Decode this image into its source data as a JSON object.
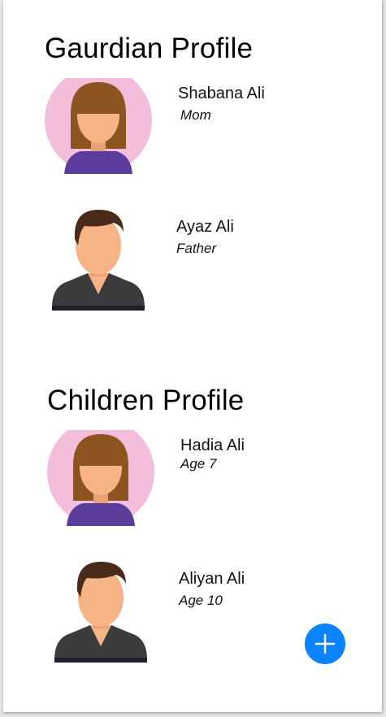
{
  "guardian_section": {
    "title": "Gaurdian Profile",
    "members": [
      {
        "name": "Shabana Ali",
        "role": "Mom",
        "avatar_icon": "female-avatar-icon"
      },
      {
        "name": "Ayaz Ali",
        "role": "Father",
        "avatar_icon": "male-avatar-icon"
      }
    ]
  },
  "children_section": {
    "title": "Children Profile",
    "members": [
      {
        "name": "Hadia Ali",
        "role": "Age 7",
        "avatar_icon": "female-avatar-icon"
      },
      {
        "name": "Aliyan Ali",
        "role": "Age 10",
        "avatar_icon": "male-avatar-icon"
      }
    ]
  },
  "fab": {
    "icon": "plus-icon",
    "color": "#0a84ff"
  },
  "colors": {
    "female_avatar_bg": "#f2bedb",
    "hair_female": "#8b5420",
    "hair_male": "#4a2a18",
    "skin": "#f6b386",
    "shirt_female": "#5c3c9a",
    "shirt_male": "#3b3b3b"
  }
}
